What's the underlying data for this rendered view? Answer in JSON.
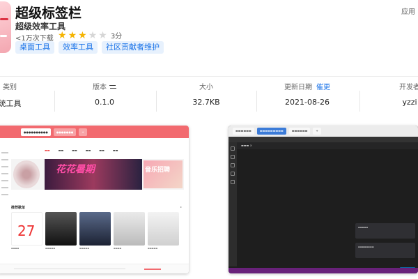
{
  "app": {
    "title": "超级标签栏",
    "subtitle": "超级效率工具",
    "downloads": "<1万次下载",
    "rating_text": "3分",
    "rating_value": 3,
    "rating_max": 5,
    "tags": [
      "桌面工具",
      "效率工具",
      "社区贡献者维护"
    ],
    "install_label": "应用"
  },
  "info": {
    "category": {
      "label": "类别",
      "value": "统工具"
    },
    "version": {
      "label": "版本",
      "value": "0.1.0"
    },
    "size": {
      "label": "大小",
      "value": "32.7KB"
    },
    "updated": {
      "label": "更新日期",
      "link": "催更",
      "value": "2021-08-26"
    },
    "developer": {
      "label": "开发者",
      "value": "yzzi"
    }
  },
  "screenshots": {
    "music": {
      "tabs": [
        "",
        "",
        ""
      ],
      "banner_text_1": "花花暑期",
      "banner_text_2": "音乐招聘",
      "section_title": "推荐歌单",
      "card_number": "27"
    },
    "vscode": {
      "tabs": [
        "",
        "",
        "",
        ""
      ]
    }
  },
  "colors": {
    "accent_blue": "#1a73e8",
    "star_on": "#f5b400",
    "music_red": "#f26a6f"
  }
}
